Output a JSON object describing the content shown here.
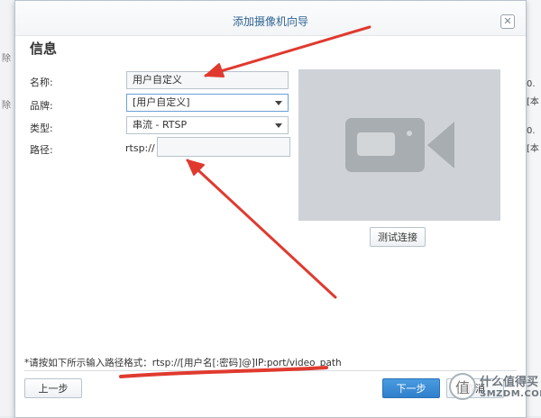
{
  "background": {
    "left_rows": [
      "除",
      "除"
    ],
    "right_values": [
      "0.",
      "[本",
      "0.",
      "[本"
    ]
  },
  "dialog": {
    "title": "添加摄像机向导",
    "close_glyph": "✕",
    "section_title": "信息",
    "fields": {
      "name_label": "名称:",
      "name_value": "用户自定义",
      "brand_label": "品牌:",
      "brand_value": "[用户自定义]",
      "type_label": "类型:",
      "type_value": "串流 - RTSP",
      "path_label": "路径:",
      "path_prefix": "rtsp://",
      "path_value": ""
    },
    "preview": {
      "icon": "video-camera-icon"
    },
    "test_button": "测试连接",
    "hint": "*请按如下所示输入路径格式：rtsp://[用户名[:密码]@]IP:port/video_path",
    "buttons": {
      "back": "上一步",
      "next": "下一步",
      "cancel": "取消"
    }
  },
  "watermark": {
    "line1": "什么值得买",
    "line2": "SMZDM.COM",
    "glyph": "值"
  },
  "annotations": {
    "arrow_color": "#e03a2f",
    "underline_color": "#e03a2f"
  }
}
